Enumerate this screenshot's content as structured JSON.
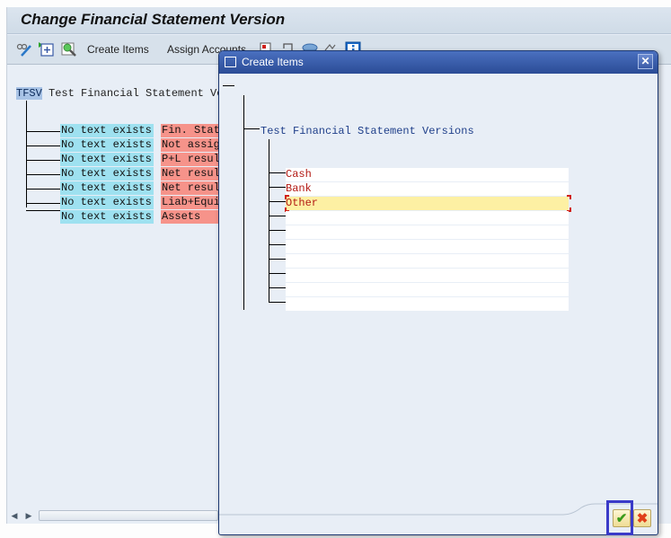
{
  "window": {
    "title": "Change Financial Statement Version"
  },
  "toolbar": {
    "icons": [
      "display-change-icon",
      "expand-node-icon",
      "find-icon"
    ],
    "create_items_label": "Create Items",
    "assign_accounts_label": "Assign Accounts",
    "extra_icons": [
      "delete-node-icon",
      "reassign-icon",
      "cut-icon",
      "select-icon",
      "info-icon"
    ]
  },
  "tree": {
    "root_key": "TFSV",
    "root_text": "Test Financial Statement Versions",
    "children": [
      {
        "text": "No text exists",
        "desc": "Fin. Statement notes"
      },
      {
        "text": "No text exists",
        "desc": "Not assigned"
      },
      {
        "text": "No text exists",
        "desc": "P+L result"
      },
      {
        "text": "No text exists",
        "desc": "Net result: profit"
      },
      {
        "text": "No text exists",
        "desc": "Net result: loss"
      },
      {
        "text": "No text exists",
        "desc": "Liab+Equity"
      },
      {
        "text": "No text exists",
        "desc": "Assets"
      }
    ]
  },
  "dialog": {
    "title": "Create Items",
    "parent_node": "Test Financial Statement Versions",
    "items": [
      "Cash",
      "Bank",
      "Other",
      "",
      "",
      "",
      "",
      "",
      "",
      ""
    ],
    "selected_index": 2,
    "ok_icon": "checkmark-icon",
    "cancel_icon": "cancel-icon"
  },
  "colors": {
    "title_bar": "#2b4c96",
    "node_text": "#b31a14",
    "selected_row": "#fdf0a3",
    "cyan_cell": "#9ee1f0",
    "red_cell": "#f6938a"
  }
}
